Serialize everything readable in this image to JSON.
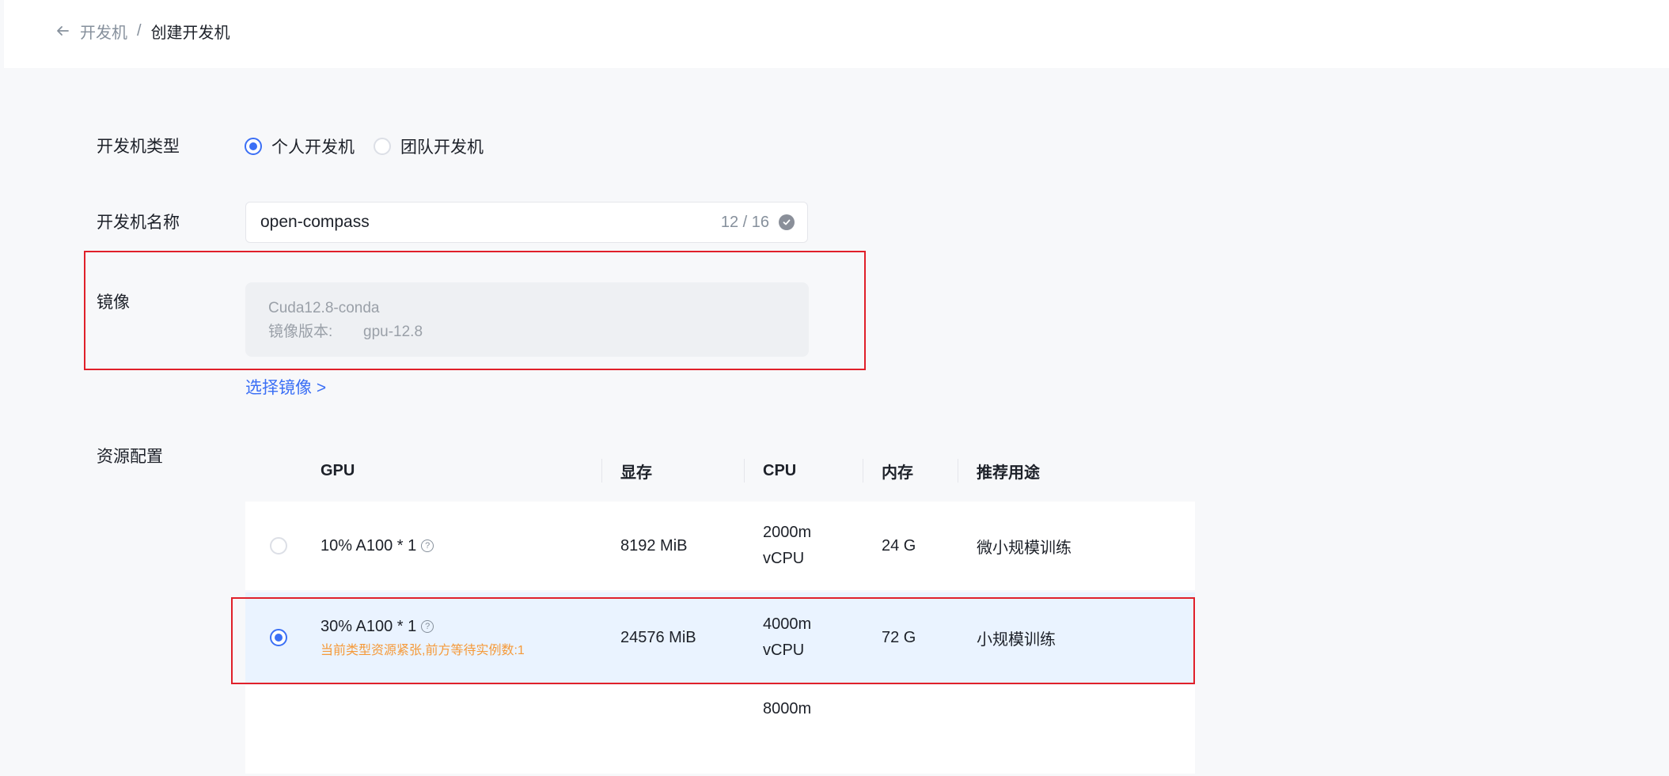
{
  "breadcrumb": {
    "parent": "开发机",
    "separator": "/",
    "current": "创建开发机"
  },
  "form": {
    "type": {
      "label": "开发机类型",
      "options": [
        {
          "label": "个人开发机",
          "checked": true
        },
        {
          "label": "团队开发机",
          "checked": false
        }
      ]
    },
    "name": {
      "label": "开发机名称",
      "value": "open-compass",
      "count": "12 / 16"
    },
    "image": {
      "label": "镜像",
      "name": "Cuda12.8-conda",
      "version_label": "镜像版本:",
      "version_value": "gpu-12.8",
      "select_link": "选择镜像 >"
    },
    "resources": {
      "label": "资源配置",
      "columns": [
        "GPU",
        "显存",
        "CPU",
        "内存",
        "推荐用途"
      ],
      "rows": [
        {
          "gpu": "10% A100 * 1",
          "mem": "8192 MiB",
          "cpu1": "2000m",
          "cpu2": "vCPU",
          "ram": "24 G",
          "use": "微小规模训练",
          "warning": "",
          "selected": false
        },
        {
          "gpu": "30% A100 * 1",
          "mem": "24576 MiB",
          "cpu1": "4000m",
          "cpu2": "vCPU",
          "ram": "72 G",
          "use": "小规模训练",
          "warning": "当前类型资源紧张,前方等待实例数:1",
          "selected": true
        },
        {
          "gpu": "",
          "mem": "",
          "cpu1": "8000m",
          "cpu2": "",
          "ram": "",
          "use": "",
          "warning": "",
          "selected": false
        }
      ]
    }
  },
  "colors": {
    "accent": "#3b6ff5",
    "highlight": "#e0202a",
    "warning": "#f59a3a"
  }
}
